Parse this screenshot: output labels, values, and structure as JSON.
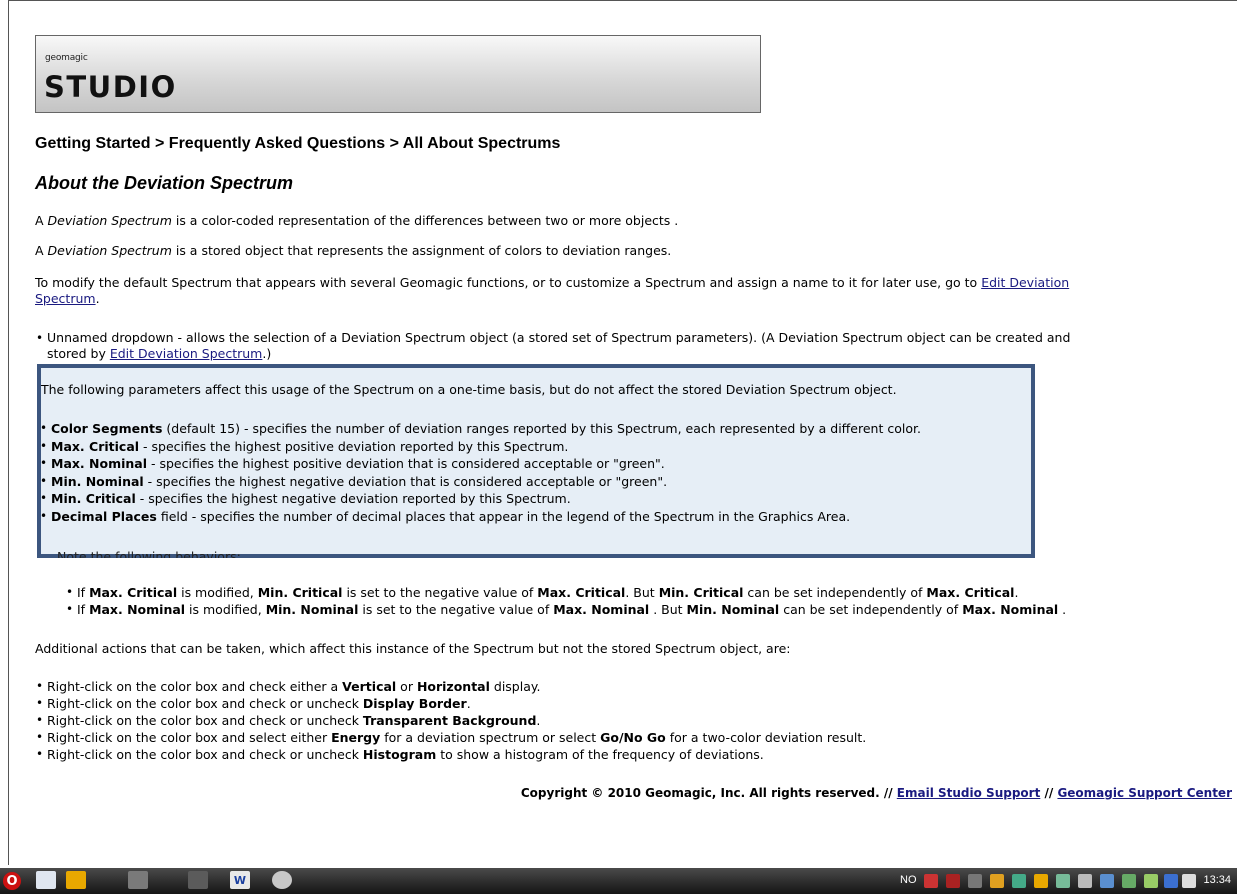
{
  "logo": {
    "small": "geomagic",
    "big": "STUDIO"
  },
  "breadcrumb": "Getting Started > Frequently Asked Questions > All About Spectrums",
  "title": "About the Deviation Spectrum",
  "para1": {
    "pre": "A ",
    "em": "Deviation Spectrum",
    "post": " is a color-coded representation of the differences between two or more objects ."
  },
  "para2": {
    "pre": "A ",
    "em": "Deviation Spectrum",
    "post": " is a stored object that represents the assignment of colors to deviation ranges."
  },
  "para3": {
    "line1": "To modify the default Spectrum that appears with several Geomagic functions, or to customize a Spectrum and assign a name to it for later use, go to ",
    "link1": "Edit Deviation",
    "link2": "Spectrum",
    "tail": "."
  },
  "bullet_dropdown": {
    "line1": "Unnamed dropdown - allows the selection of a Deviation Spectrum object (a stored set of Spectrum parameters). (A Deviation Spectrum object can be created and",
    "line2_pre": "stored by ",
    "link": "Edit Deviation Spectrum",
    "line2_post": ".)"
  },
  "highlight": {
    "intro": "The following parameters affect this usage of the Spectrum on a one-time basis, but do not affect the stored Deviation Spectrum object.",
    "items": [
      {
        "b": "Color Segments",
        "t": " (default 15) - specifies the number of deviation ranges reported by this Spectrum, each represented by a different color."
      },
      {
        "b": "Max. Critical",
        "t": " - specifies the highest positive deviation reported by this Spectrum."
      },
      {
        "b": "Max. Nominal",
        "t": " - specifies the highest positive deviation that is considered acceptable or \"green\"."
      },
      {
        "b": "Min. Nominal",
        "t": " - specifies the highest negative deviation that is considered acceptable or \"green\"."
      },
      {
        "b": "Min. Critical",
        "t": " - specifies the highest negative deviation reported by this Spectrum."
      },
      {
        "b": "Decimal Places",
        "t": " field - specifies the number of decimal places that appear in the legend of the Spectrum in the Graphics Area."
      }
    ]
  },
  "note": "Note the following behaviors:",
  "behaviors": [
    {
      "a": "If ",
      "b1": "Max. Critical",
      "c": " is modified, ",
      "b2": "Min. Critical",
      "d": " is set to the negative value of ",
      "b3": "Max. Critical",
      "e": ". But ",
      "b4": "Min. Critical",
      "f": " can be set independently of ",
      "b5": "Max. Critical",
      "g": "."
    },
    {
      "a": "If ",
      "b1": "Max. Nominal",
      "c": " is modified, ",
      "b2": "Min. Nominal",
      "d": " is set to the negative value of ",
      "b3": "Max. Nominal",
      "e": " . But ",
      "b4": "Min. Nominal",
      "f": " can be set independently of ",
      "b5": "Max. Nominal",
      "g": " ."
    }
  ],
  "additional": "Additional actions that can be taken, which affect this instance of the Spectrum but not the stored Spectrum object, are:",
  "actions": [
    {
      "pre": "Right-click on the color box and check either a ",
      "b1": "Vertical",
      "mid": " or ",
      "b2": "Horizontal",
      "post": " display."
    },
    {
      "pre": "Right-click on the color box and check or uncheck ",
      "b1": "Display Border",
      "mid": "",
      "b2": "",
      "post": "."
    },
    {
      "pre": "Right-click on the color box and check or uncheck ",
      "b1": "Transparent Background",
      "mid": "",
      "b2": "",
      "post": "."
    },
    {
      "pre": "Right-click on the color box and select either ",
      "b1": "Energy",
      "mid": " for a deviation spectrum or select ",
      "b2": "Go/No Go",
      "post": " for a two-color deviation result."
    },
    {
      "pre": "Right-click on the color box and check or uncheck ",
      "b1": "Histogram",
      "mid": "",
      "b2": "",
      "post": " to show a histogram of the frequency of deviations."
    }
  ],
  "copyright": {
    "text": "Copyright © 2010 Geomagic, Inc. All rights reserved.  // ",
    "link1": "Email Studio Support",
    "sep": " // ",
    "link2": "Geomagic Support Center"
  },
  "taskbar": {
    "lang": "NO",
    "clock": "13:34"
  },
  "colors": {
    "highlight_bg": "#e6eef6",
    "highlight_border": "#3c567f",
    "link": "#1a1a80"
  }
}
